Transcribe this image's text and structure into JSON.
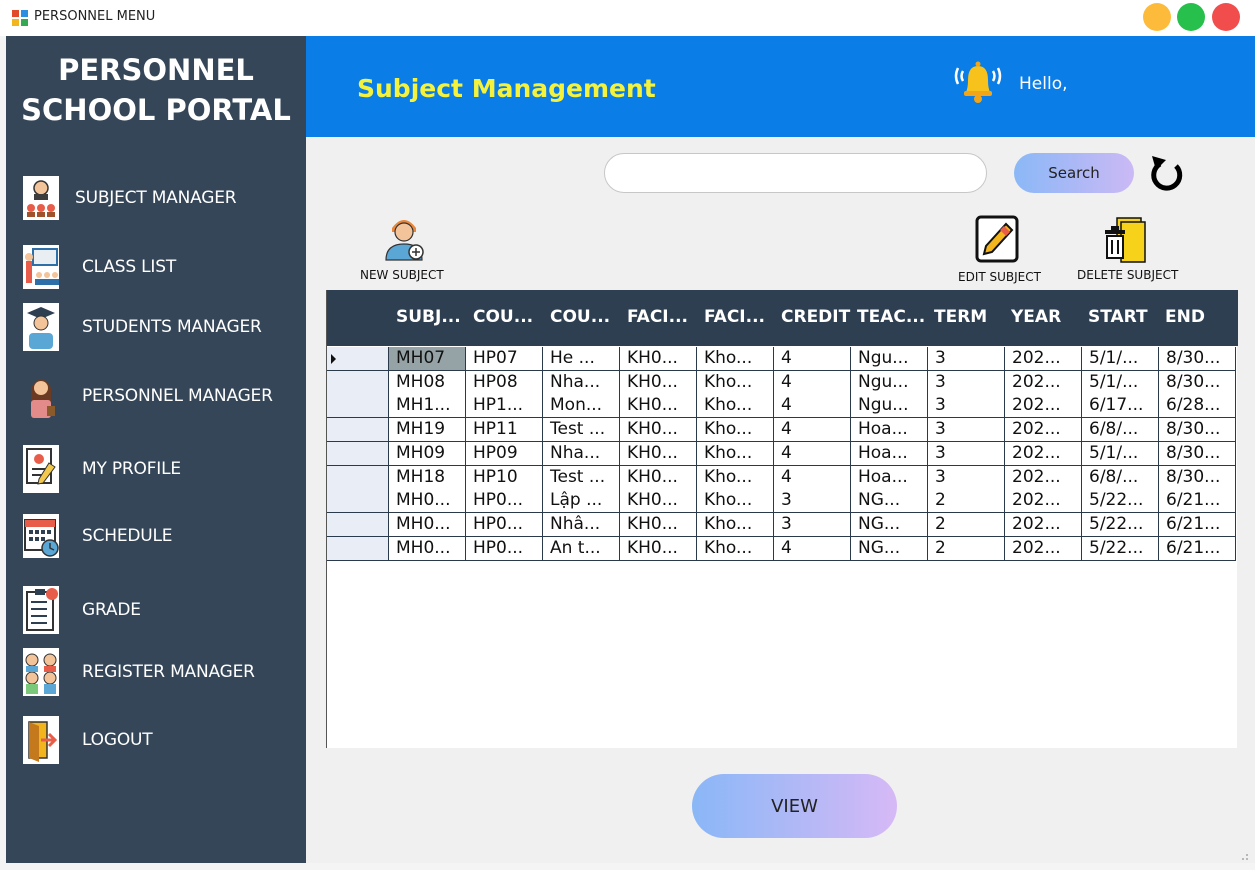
{
  "window": {
    "title": "PERSONNEL MENU"
  },
  "sidebar": {
    "brand_line1": "PERSONNEL",
    "brand_line2": "SCHOOL PORTAL",
    "items": [
      {
        "label": "SUBJECT MANAGER",
        "icon": "subject-manager-icon"
      },
      {
        "label": "CLASS LIST",
        "icon": "class-list-icon"
      },
      {
        "label": "STUDENTS MANAGER",
        "icon": "student-icon"
      },
      {
        "label": "PERSONNEL MANAGER",
        "icon": "personnel-icon"
      },
      {
        "label": "MY PROFILE",
        "icon": "profile-icon"
      },
      {
        "label": "SCHEDULE",
        "icon": "calendar-icon"
      },
      {
        "label": "GRADE",
        "icon": "grade-icon"
      },
      {
        "label": "REGISTER MANAGER",
        "icon": "register-icon"
      },
      {
        "label": "LOGOUT",
        "icon": "logout-icon"
      }
    ]
  },
  "header": {
    "title": "Subject Management",
    "greeting": "Hello,"
  },
  "search": {
    "placeholder": "",
    "value": "",
    "button_label": "Search"
  },
  "toolbar": {
    "new_label": "NEW SUBJECT",
    "edit_label": "EDIT SUBJECT",
    "delete_label": "DELETE SUBJECT"
  },
  "table": {
    "columns": [
      "SUBJ...",
      "COU...",
      "COU...",
      "FACI...",
      "FACI...",
      "CREDIT",
      "TEAC...",
      "TERM",
      "YEAR",
      "START",
      "END"
    ],
    "rows": [
      [
        "MH07",
        "HP07",
        "He ...",
        "KH0...",
        "Kho...",
        "4",
        "Ngu...",
        "3",
        "202...",
        "5/1/...",
        "8/30..."
      ],
      [
        "MH08",
        "HP08",
        "Nha...",
        "KH0...",
        "Kho...",
        "4",
        "Ngu...",
        "3",
        "202...",
        "5/1/...",
        "8/30..."
      ],
      [
        "MH1...",
        "HP1...",
        "Mon...",
        "KH0...",
        "Kho...",
        "4",
        "Ngu...",
        "3",
        "202...",
        "6/17...",
        "6/28..."
      ],
      [
        "MH19",
        "HP11",
        "Test ...",
        "KH0...",
        "Kho...",
        "4",
        "Hoa...",
        "3",
        "202...",
        "6/8/...",
        "8/30..."
      ],
      [
        "MH09",
        "HP09",
        "Nha...",
        "KH0...",
        "Kho...",
        "4",
        "Hoa...",
        "3",
        "202...",
        "5/1/...",
        "8/30..."
      ],
      [
        "MH18",
        "HP10",
        "Test ...",
        "KH0...",
        "Kho...",
        "4",
        "Hoa...",
        "3",
        "202...",
        "6/8/...",
        "8/30..."
      ],
      [
        "MH0...",
        "HP0...",
        "Lập ...",
        "KH0...",
        "Kho...",
        "3",
        "NG...",
        "2",
        "202...",
        "5/22...",
        "6/21..."
      ],
      [
        "MH0...",
        "HP0...",
        "Nhâ...",
        "KH0...",
        "Kho...",
        "3",
        "NG...",
        "2",
        "202...",
        "5/22...",
        "6/21..."
      ],
      [
        "MH0...",
        "HP0...",
        "An t...",
        "KH0...",
        "Kho...",
        "4",
        "NG...",
        "2",
        "202...",
        "5/22...",
        "6/21..."
      ]
    ],
    "selected_row": 0
  },
  "actions": {
    "view_label": "VIEW"
  },
  "colors": {
    "sidebar_bg": "#354658",
    "header_bg": "#0a7de6",
    "header_title": "#f4f23c",
    "grid_header_bg": "#2f3f52"
  }
}
